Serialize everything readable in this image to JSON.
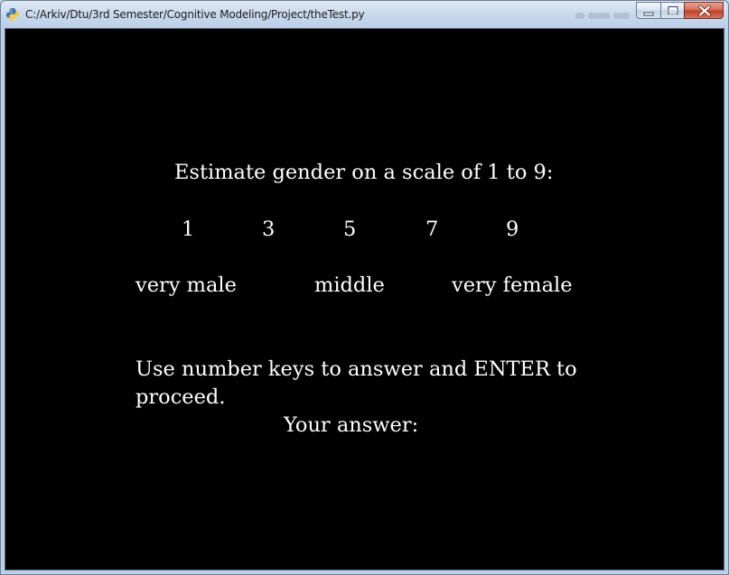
{
  "window": {
    "title": "C:/Arkiv/Dtu/3rd Semester/Cognitive Modeling/Project/theTest.py",
    "icon": "python-icon",
    "controls": [
      "minimize-icon",
      "maximize-icon",
      "close-icon"
    ]
  },
  "content": {
    "prompt": "Estimate gender on a scale of 1 to 9:",
    "scale_numbers": [
      "1",
      "3",
      "5",
      "7",
      "9"
    ],
    "scale_labels": {
      "low": "very male",
      "mid": "middle",
      "high": "very female"
    },
    "instruction_line1": "Use number keys to answer and ENTER to",
    "instruction_line2": "proceed.",
    "answer_label": "Your answer:",
    "answer_value": ""
  },
  "colors": {
    "background": "#000000",
    "text": "#ffffff",
    "close_button": "#c2412a"
  }
}
